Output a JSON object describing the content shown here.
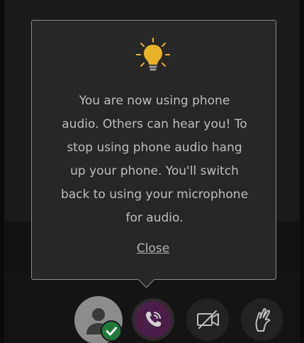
{
  "tooltip": {
    "icon": "lightbulb-icon",
    "message_lines": [
      "You are now using phone",
      "audio. Others can hear you! To",
      "stop using phone audio hang",
      "up your phone. You'll switch",
      "back to using your microphone",
      "for audio."
    ],
    "close_label": "Close"
  },
  "controls": {
    "avatar": {
      "icon": "user-icon",
      "status_icon": "checkmark-icon",
      "status_color": "#1f7a3a"
    },
    "phone": {
      "icon": "phone-icon",
      "active": true,
      "accent": "#4a1e49"
    },
    "camera": {
      "icon": "camera-off-icon",
      "active": false
    },
    "hand": {
      "icon": "raise-hand-icon",
      "active": false
    }
  },
  "colors": {
    "tooltip_bg": "#272727",
    "text": "#bdbdbd",
    "lightbulb": "#e8b12a"
  }
}
